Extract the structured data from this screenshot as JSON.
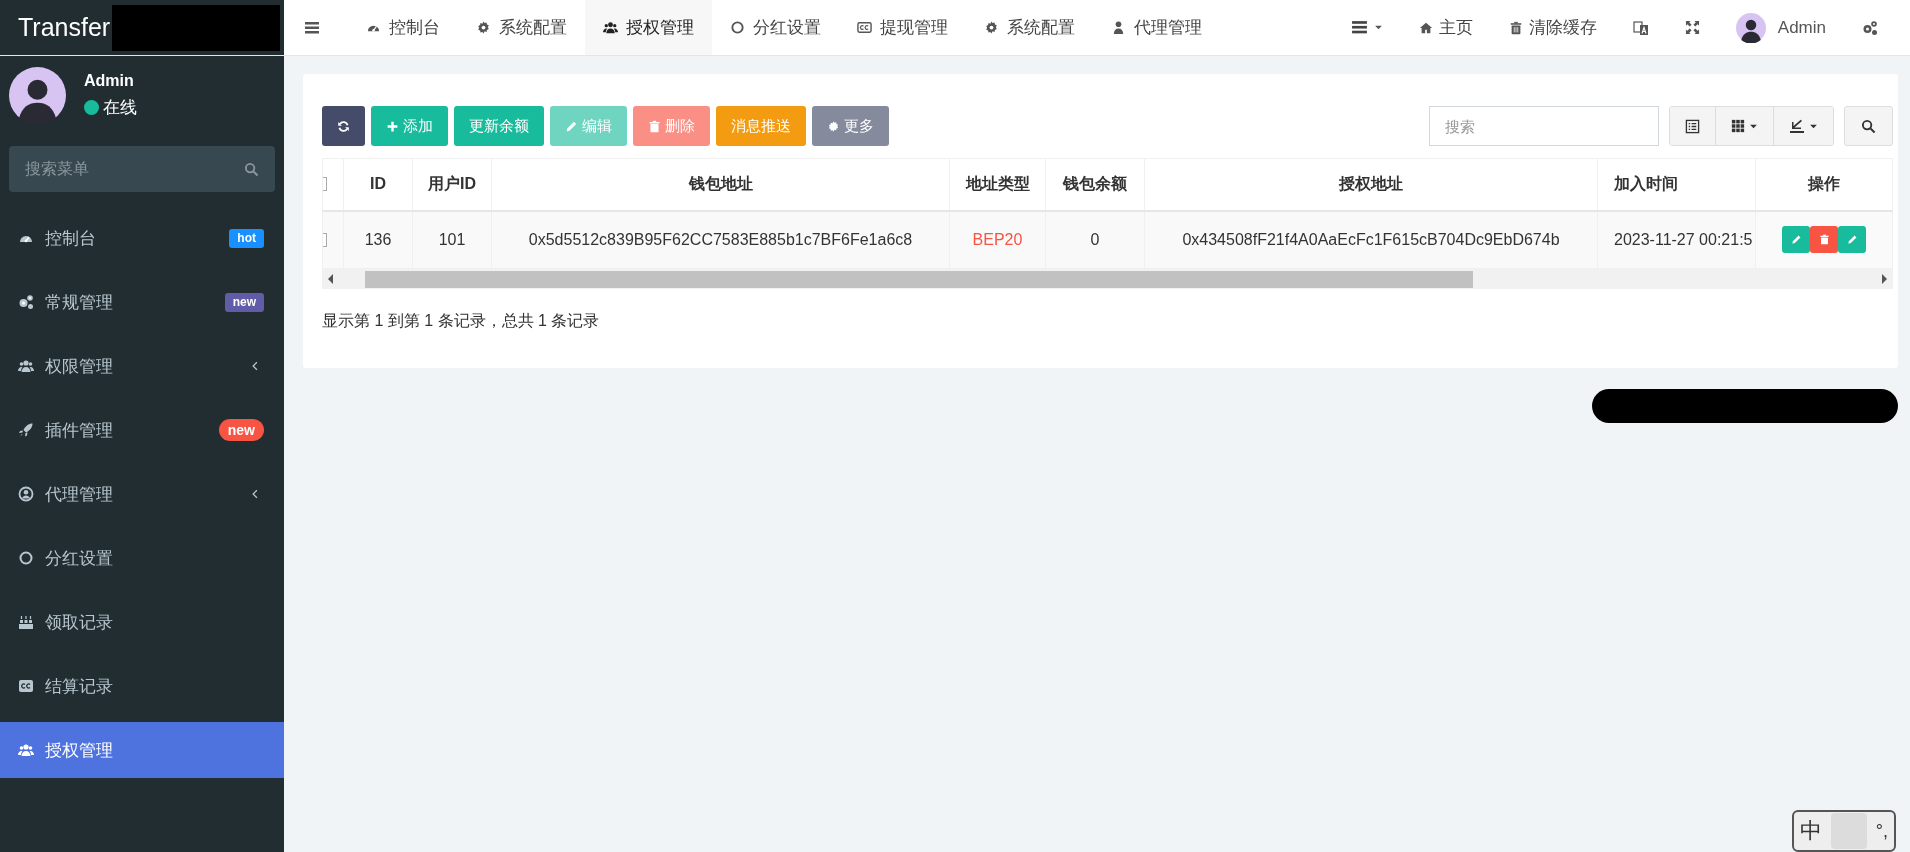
{
  "logo": {
    "text": "Transfer"
  },
  "top_nav": {
    "tabs": [
      {
        "label": "控制台",
        "selected": false
      },
      {
        "label": "系统配置",
        "selected": false
      },
      {
        "label": "授权管理",
        "selected": true
      },
      {
        "label": "分红设置",
        "selected": false
      },
      {
        "label": "提现管理",
        "selected": false
      },
      {
        "label": "系统配置",
        "selected": false
      },
      {
        "label": "代理管理",
        "selected": false
      }
    ],
    "links": [
      {
        "label": "主页"
      },
      {
        "label": "清除缓存"
      }
    ],
    "user": {
      "name": "Admin"
    }
  },
  "sidebar": {
    "user": {
      "name": "Admin",
      "status": "在线",
      "online": true
    },
    "search": {
      "placeholder": "搜索菜单"
    },
    "items": [
      {
        "label": "控制台",
        "kind": "link",
        "selected": false,
        "badge": {
          "text": "hot",
          "kind": "label",
          "color": "#1890ff"
        }
      },
      {
        "label": "常规管理",
        "kind": "link",
        "selected": false,
        "badge": {
          "text": "new",
          "kind": "label",
          "color": "#605ca8"
        }
      },
      {
        "label": "权限管理",
        "kind": "tree",
        "selected": false,
        "expanded": false
      },
      {
        "label": "插件管理",
        "kind": "link",
        "selected": false,
        "badge": {
          "text": "new",
          "kind": "pill",
          "color": "#f75444"
        }
      },
      {
        "label": "代理管理",
        "kind": "tree",
        "selected": false,
        "expanded": false
      },
      {
        "label": "分红设置",
        "kind": "link",
        "selected": false
      },
      {
        "label": "领取记录",
        "kind": "link",
        "selected": false
      },
      {
        "label": "结算记录",
        "kind": "link",
        "selected": false
      },
      {
        "label": "授权管理",
        "kind": "link",
        "selected": true
      }
    ]
  },
  "toolbar": {
    "buttons": [
      {
        "kind": "refresh",
        "color": "#444c69"
      },
      {
        "label": "添加",
        "kind": "add",
        "color": "#18bc9c"
      },
      {
        "label": "更新余额",
        "kind": "plain",
        "color": "#18bc9c"
      },
      {
        "label": "编辑",
        "kind": "edit",
        "color": "#6fd5c1"
      },
      {
        "label": "删除",
        "kind": "delete",
        "color": "#fa8f85"
      },
      {
        "label": "消息推送",
        "kind": "plain",
        "color": "#f39c12"
      },
      {
        "label": "更多",
        "kind": "more",
        "color": "#858a9d"
      }
    ],
    "search": {
      "placeholder": "搜索"
    }
  },
  "table": {
    "columns": [
      "ID",
      "用户ID",
      "钱包地址",
      "地址类型",
      "钱包余额",
      "授权地址",
      "加入时间",
      "操作"
    ],
    "all_checked": false,
    "rows": [
      {
        "checked": false,
        "cells": [
          {
            "text": "136"
          },
          {
            "text": "101"
          },
          {
            "text": "0x5d5512c839B95F62CC7583E885b1c7BF6Fe1a6c8"
          },
          {
            "text": "BEP20",
            "color": "#f75444"
          },
          {
            "text": "0"
          },
          {
            "text": "0x434508fF21f4A0AaEcFc1F615cB704Dc9EbD674b"
          },
          {
            "text": "2023-11-27 00:21:5"
          }
        ]
      }
    ],
    "summary": "显示第 1 到第 1 条记录，总共 1 条记录"
  },
  "ime_widget": {
    "label": "中",
    "mark": "°,"
  }
}
